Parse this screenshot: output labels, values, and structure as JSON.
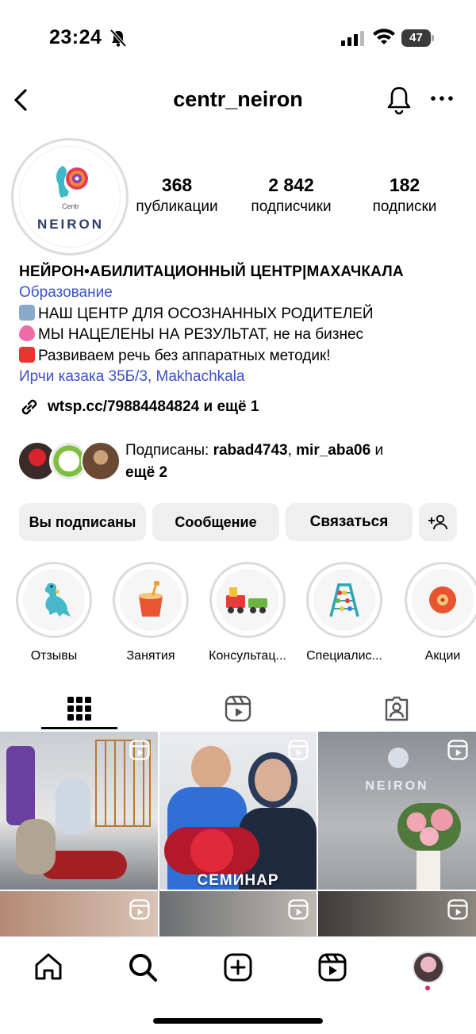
{
  "status": {
    "time": "23:24",
    "battery": "47"
  },
  "header": {
    "title": "centr_neiron"
  },
  "logo": {
    "small": "Centr",
    "text": "NEIRON"
  },
  "stats": [
    {
      "num": "368",
      "label": "публикации"
    },
    {
      "num": "2 842",
      "label": "подписчики"
    },
    {
      "num": "182",
      "label": "подписки"
    }
  ],
  "bio": {
    "name": "НЕЙРОН•АБИЛИТАЦИОННЫЙ ЦЕНТР|МАХАЧКАЛА",
    "category": "Образование",
    "line1": "НАШ ЦЕНТР ДЛЯ ОСОЗНАННЫХ РОДИТЕЛЕЙ",
    "line2": "МЫ НАЦЕЛЕНЫ НА РЕЗУЛЬТАТ, не на бизнес",
    "line3": "Развиваем речь без аппаратных методик!",
    "location": "Ирчи казака 35Б/3, Makhachkala",
    "link": "wtsp.cc/79884484824 и ещё 1"
  },
  "followed_by": {
    "prefix": "Подписаны: ",
    "user1": "rabad4743",
    "sep": ", ",
    "user2": "mir_aba06",
    "mid": " и ",
    "more": "ещё 2"
  },
  "buttons": {
    "following": "Вы подписаны",
    "message": "Сообщение",
    "contact": "Связаться"
  },
  "highlights": [
    {
      "label": "Отзывы"
    },
    {
      "label": "Занятия"
    },
    {
      "label": "Консультац..."
    },
    {
      "label": "Специалис..."
    },
    {
      "label": "Акции"
    }
  ],
  "grid": {
    "seminar_caption": "СЕМИНАР",
    "wall_logo": "NEIRON"
  },
  "colors": {
    "link": "#3a4fd0",
    "button_bg": "#efefef",
    "notification_dot": "#e0245e"
  }
}
